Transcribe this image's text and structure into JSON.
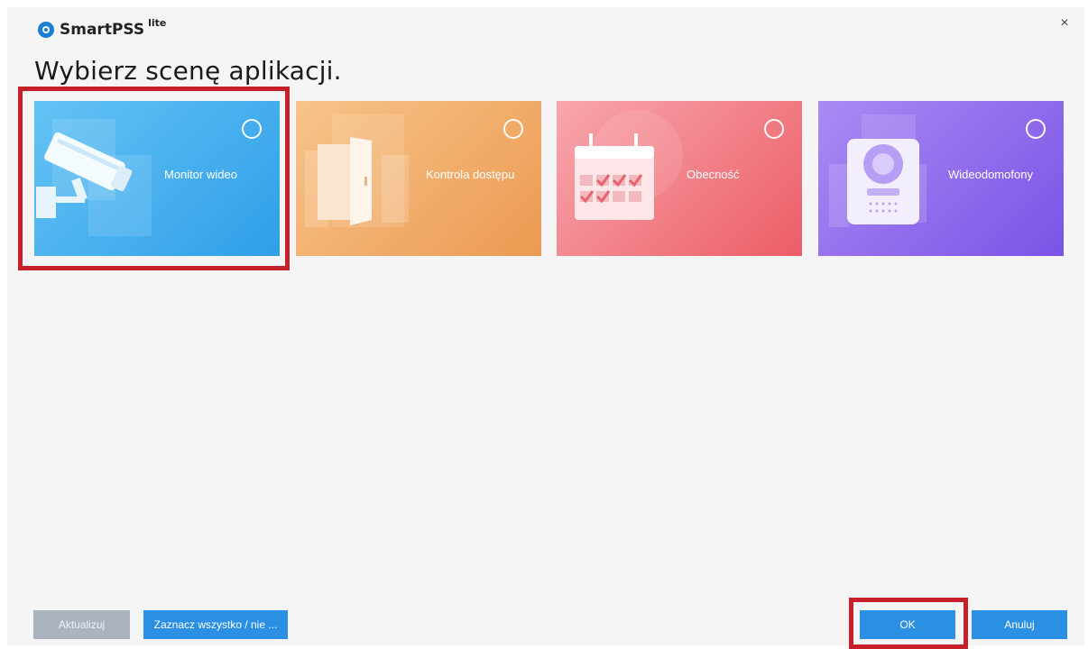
{
  "app": {
    "brand_name": "SmartPSS",
    "brand_suffix": "lite",
    "close_glyph": "×"
  },
  "page": {
    "title": "Wybierz scenę aplikacji."
  },
  "scenes": [
    {
      "label": "Monitor wideo",
      "icon": "surveillance-camera-icon",
      "color": "#3aa7ec",
      "selected": false
    },
    {
      "label": "Kontrola dostępu",
      "icon": "door-icon",
      "color": "#ef9e58",
      "selected": false
    },
    {
      "label": "Obecność",
      "icon": "calendar-icon",
      "color": "#ef6670",
      "selected": false
    },
    {
      "label": "Wideodomofony",
      "icon": "intercom-icon",
      "color": "#8a63ea",
      "selected": false
    }
  ],
  "footer": {
    "update_label": "Aktualizuj",
    "select_all_label": "Zaznacz wszystko / nie ...",
    "ok_label": "OK",
    "cancel_label": "Anuluj"
  },
  "colors": {
    "accent": "#2b8fe4",
    "highlight": "#c8202b",
    "disabled": "#aab3bf"
  }
}
